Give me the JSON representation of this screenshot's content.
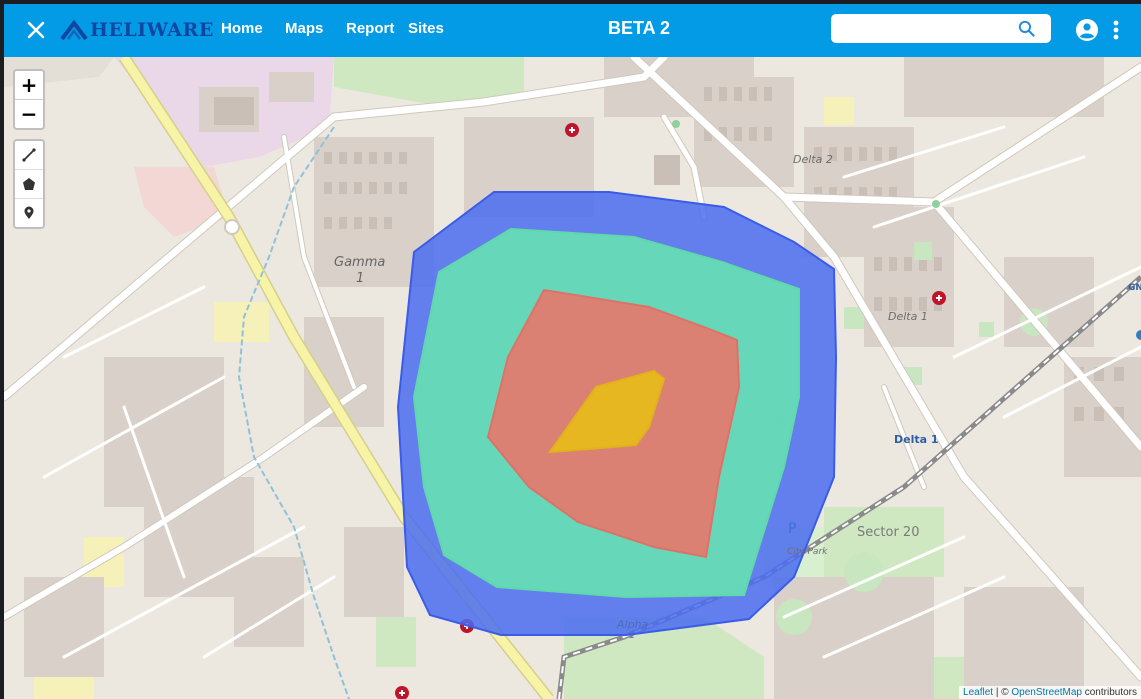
{
  "header": {
    "logo_text": "HELIWARE",
    "nav": [
      "Home",
      "Maps",
      "Report",
      "Sites"
    ],
    "title": "BETA 2",
    "search_placeholder": ""
  },
  "map": {
    "labels": {
      "gamma": "Gamma",
      "gamma_num": "1",
      "delta2": "Delta 2",
      "delta1": "Delta 1",
      "station": "Delta 1",
      "sector20": "Sector 20",
      "city_park": "City Park",
      "alpha": "Alpha",
      "alpha_num": "1",
      "parking": "P",
      "edge_label": "GN"
    },
    "zoom_in": "+",
    "zoom_out": "−",
    "draw_tools": [
      "polyline-icon",
      "polygon-icon",
      "marker-icon"
    ],
    "zones_colors": [
      "#4a6cf0",
      "#66e0b4",
      "#e27c70",
      "#e6b820"
    ]
  },
  "attribution": {
    "leaflet": "Leaflet",
    "separator": " | © ",
    "osm": "OpenStreetMap",
    "suffix": " contributors"
  },
  "colors": {
    "header": "#039be5",
    "logo": "#0d47a1"
  }
}
